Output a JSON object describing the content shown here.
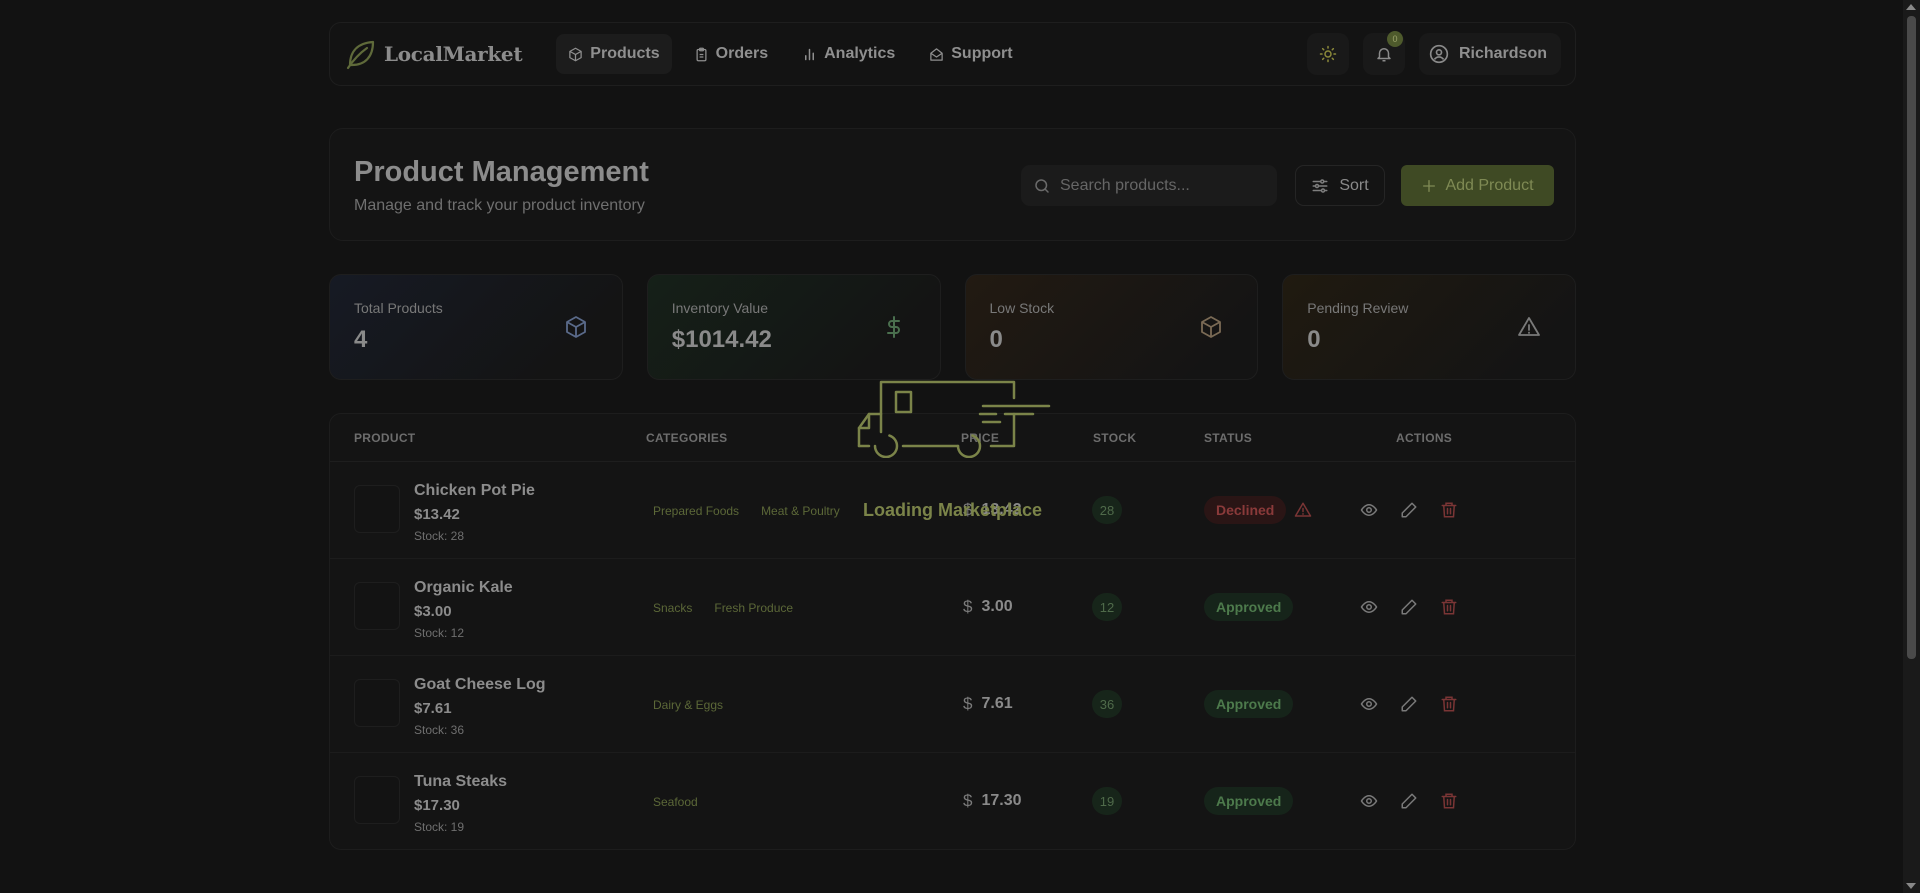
{
  "nav": {
    "logo_text": "LocalMarket",
    "links": [
      {
        "label": "Products",
        "icon": "box-icon",
        "active": true
      },
      {
        "label": "Orders",
        "icon": "clipboard-icon"
      },
      {
        "label": "Analytics",
        "icon": "bar-chart-icon"
      },
      {
        "label": "Support",
        "icon": "mail-open-icon"
      }
    ],
    "notification_count": "0",
    "user_name": "Richardson"
  },
  "header": {
    "title": "Product Management",
    "subtitle": "Manage and track your product inventory",
    "search_placeholder": "Search products...",
    "sort_label": "Sort",
    "add_label": "Add Product"
  },
  "stats": [
    {
      "label": "Total Products",
      "value": "4",
      "icon": "box-icon"
    },
    {
      "label": "Inventory Value",
      "value": "$1014.42",
      "icon": "dollar-icon"
    },
    {
      "label": "Low Stock",
      "value": "0",
      "icon": "box-icon"
    },
    {
      "label": "Pending Review",
      "value": "0",
      "icon": "alert-triangle-icon"
    }
  ],
  "table": {
    "headers": {
      "product": "PRODUCT",
      "categories": "CATEGORIES",
      "price": "PRICE",
      "stock": "STOCK",
      "status": "STATUS",
      "actions": "ACTIONS"
    },
    "rows": [
      {
        "name": "Chicken Pot Pie",
        "price": "$13.42",
        "stock_text": "Stock: 28",
        "categories": [
          "Prepared Foods",
          "Meat & Poultry"
        ],
        "price_value": "13.42",
        "stock": "28",
        "status": "Declined"
      },
      {
        "name": "Organic Kale",
        "price": "$3.00",
        "stock_text": "Stock: 12",
        "categories": [
          "Snacks",
          "Fresh Produce"
        ],
        "price_value": "3.00",
        "stock": "12",
        "status": "Approved"
      },
      {
        "name": "Goat Cheese Log",
        "price": "$7.61",
        "stock_text": "Stock: 36",
        "categories": [
          "Dairy & Eggs"
        ],
        "price_value": "7.61",
        "stock": "36",
        "status": "Approved"
      },
      {
        "name": "Tuna Steaks",
        "price": "$17.30",
        "stock_text": "Stock: 19",
        "categories": [
          "Seafood"
        ],
        "price_value": "17.30",
        "stock": "19",
        "status": "Approved"
      }
    ]
  },
  "loading": {
    "text": "Loading Marketplace",
    "icon": "delivery-truck-icon"
  },
  "colors": {
    "accent": "#7b8449",
    "approved": "#4d7a4c",
    "declined": "#8a3a3a"
  }
}
